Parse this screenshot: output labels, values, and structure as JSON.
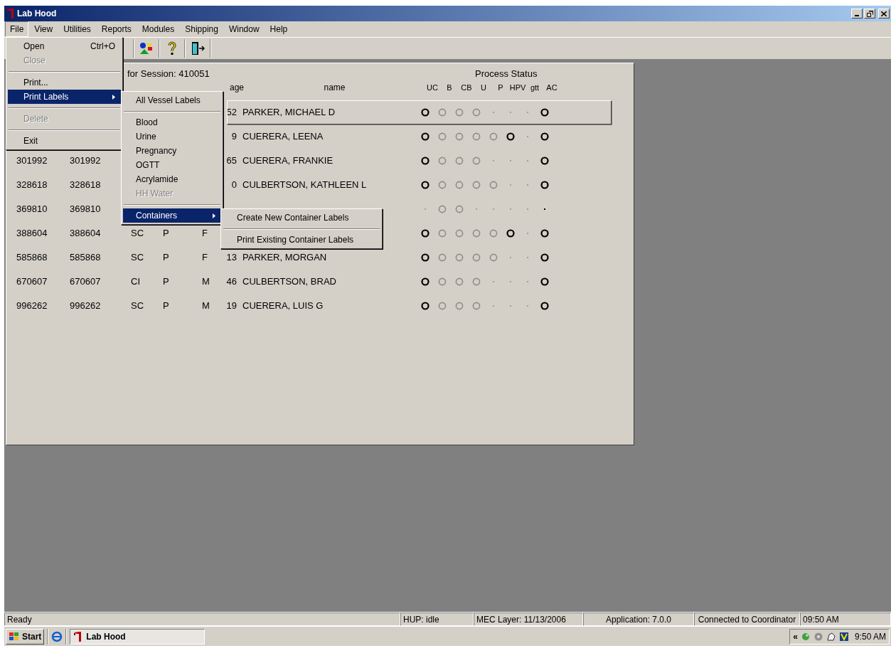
{
  "window": {
    "title": "Lab Hood"
  },
  "menu_bar": [
    {
      "label": "File",
      "selected": true
    },
    {
      "label": "View",
      "selected": false
    },
    {
      "label": "Utilities",
      "selected": false
    },
    {
      "label": "Reports",
      "selected": false
    },
    {
      "label": "Modules",
      "selected": false
    },
    {
      "label": "Shipping",
      "selected": false
    },
    {
      "label": "Window",
      "selected": false
    },
    {
      "label": "Help",
      "selected": false
    }
  ],
  "toolbar": [
    {
      "kind": "shapes"
    },
    {
      "kind": "help"
    },
    {
      "kind": "exit"
    }
  ],
  "participant_list": {
    "heading": "for Session: 410051",
    "process_heading": "Process Status",
    "age_header": "age",
    "name_header": "name",
    "status_columns": [
      "UC",
      "B",
      "CB",
      "U",
      "P",
      "HPV",
      "gtt",
      "AC"
    ],
    "rows": [
      {
        "selected": true,
        "age": "52",
        "name": "PARKER, MICHAEL D",
        "status": [
          {
            "kind": "bold"
          },
          {
            "kind": "grey"
          },
          {
            "kind": "grey"
          },
          {
            "kind": "grey"
          },
          {
            "kind": "dot"
          },
          {
            "kind": "dot"
          },
          {
            "kind": "dot"
          },
          {
            "kind": "bold"
          }
        ]
      },
      {
        "selected": false,
        "age": "9",
        "name": "CUERERA, LEENA",
        "status": [
          {
            "kind": "bold"
          },
          {
            "kind": "grey"
          },
          {
            "kind": "grey"
          },
          {
            "kind": "grey"
          },
          {
            "kind": "grey"
          },
          {
            "kind": "bold"
          },
          {
            "kind": "dot"
          },
          {
            "kind": "bold"
          }
        ]
      },
      {
        "selected": false,
        "id": "301992",
        "id_2": "301992",
        "age": "65",
        "name": "CUERERA, FRANKIE",
        "status": [
          {
            "kind": "bold"
          },
          {
            "kind": "grey"
          },
          {
            "kind": "grey"
          },
          {
            "kind": "grey"
          },
          {
            "kind": "dot"
          },
          {
            "kind": "dot"
          },
          {
            "kind": "dot"
          },
          {
            "kind": "bold"
          }
        ]
      },
      {
        "selected": false,
        "id": "328618",
        "id_2": "328618",
        "age": "0",
        "name": "CULBERTSON, KATHLEEN L",
        "status": [
          {
            "kind": "bold"
          },
          {
            "kind": "grey"
          },
          {
            "kind": "grey"
          },
          {
            "kind": "grey"
          },
          {
            "kind": "grey"
          },
          {
            "kind": "dot"
          },
          {
            "kind": "dot"
          },
          {
            "kind": "bold"
          }
        ]
      },
      {
        "selected": false,
        "id": "369810",
        "id_2": "369810",
        "status": [
          {
            "kind": "dot"
          },
          {
            "kind": "grey"
          },
          {
            "kind": "grey"
          },
          {
            "kind": "dot"
          },
          {
            "kind": "dot"
          },
          {
            "kind": "dot"
          },
          {
            "kind": "dot"
          },
          {
            "kind": "bold-dot"
          }
        ]
      },
      {
        "selected": false,
        "id": "388604",
        "id_2": "388604",
        "status_code": "SC",
        "type": "P",
        "gender": "F",
        "status": [
          {
            "kind": "bold"
          },
          {
            "kind": "grey"
          },
          {
            "kind": "grey"
          },
          {
            "kind": "grey"
          },
          {
            "kind": "grey"
          },
          {
            "kind": "bold"
          },
          {
            "kind": "dot"
          },
          {
            "kind": "bold"
          }
        ]
      },
      {
        "selected": false,
        "id": "585868",
        "id_2": "585868",
        "status_code": "SC",
        "type": "P",
        "gender": "F",
        "age": "13",
        "name": "PARKER, MORGAN",
        "status": [
          {
            "kind": "bold"
          },
          {
            "kind": "grey"
          },
          {
            "kind": "grey"
          },
          {
            "kind": "grey"
          },
          {
            "kind": "grey"
          },
          {
            "kind": "dot"
          },
          {
            "kind": "dot"
          },
          {
            "kind": "bold"
          }
        ]
      },
      {
        "selected": false,
        "id": "670607",
        "id_2": "670607",
        "status_code": "CI",
        "type": "P",
        "gender": "M",
        "age": "46",
        "name": "CULBERTSON, BRAD",
        "status": [
          {
            "kind": "bold"
          },
          {
            "kind": "grey"
          },
          {
            "kind": "grey"
          },
          {
            "kind": "grey"
          },
          {
            "kind": "dot"
          },
          {
            "kind": "dot"
          },
          {
            "kind": "dot"
          },
          {
            "kind": "bold"
          }
        ]
      },
      {
        "selected": false,
        "id": "996262",
        "id_2": "996262",
        "status_code": "SC",
        "type": "P",
        "gender": "M",
        "age": "19",
        "name": "CUERERA, LUIS G",
        "status": [
          {
            "kind": "bold"
          },
          {
            "kind": "grey"
          },
          {
            "kind": "grey"
          },
          {
            "kind": "grey"
          },
          {
            "kind": "dot"
          },
          {
            "kind": "dot"
          },
          {
            "kind": "dot"
          },
          {
            "kind": "bold"
          }
        ]
      }
    ]
  },
  "file_menu": [
    {
      "kind": "item",
      "label": "Open",
      "shortcut": "Ctrl+O",
      "disabled": false,
      "selected": false
    },
    {
      "kind": "item",
      "label": "Close",
      "disabled": true,
      "selected": false
    },
    {
      "kind": "separator"
    },
    {
      "kind": "item",
      "label": "Print...",
      "disabled": false,
      "selected": false
    },
    {
      "kind": "item",
      "label": "Print Labels",
      "disabled": false,
      "selected": true,
      "submenu": true
    },
    {
      "kind": "separator"
    },
    {
      "kind": "item",
      "label": "Delete",
      "disabled": true,
      "selected": false
    },
    {
      "kind": "separator"
    },
    {
      "kind": "item",
      "label": "Exit",
      "disabled": false,
      "selected": false
    }
  ],
  "print_labels_menu": [
    {
      "kind": "item",
      "label": "All Vessel Labels",
      "disabled": false,
      "selected": false
    },
    {
      "kind": "separator"
    },
    {
      "kind": "item",
      "label": "Blood",
      "disabled": false,
      "selected": false
    },
    {
      "kind": "item",
      "label": "Urine",
      "disabled": false,
      "selected": false
    },
    {
      "kind": "item",
      "label": "Pregnancy",
      "disabled": false,
      "selected": false
    },
    {
      "kind": "item",
      "label": "OGTT",
      "disabled": false,
      "selected": false
    },
    {
      "kind": "item",
      "label": "Acrylamide",
      "disabled": false,
      "selected": false
    },
    {
      "kind": "item",
      "label": "HH Water",
      "disabled": true,
      "selected": false
    },
    {
      "kind": "separator"
    },
    {
      "kind": "item",
      "label": "Containers",
      "disabled": false,
      "selected": true,
      "submenu": true
    }
  ],
  "containers_menu": [
    {
      "kind": "item",
      "label": "Create New Container Labels",
      "disabled": false,
      "selected": false
    },
    {
      "kind": "separator"
    },
    {
      "kind": "item",
      "label": "Print Existing Container Labels",
      "disabled": false,
      "selected": false
    }
  ],
  "status_bar": [
    "Ready",
    "HUP: idle",
    "MEC Layer: 11/13/2006",
    "Application: 7.0.0",
    "Connected to Coordinator",
    "09:50 AM"
  ],
  "taskbar": {
    "start": "Start",
    "tasks": [
      {
        "label": "Lab Hood",
        "selected": true
      }
    ],
    "tray_chevron": "«",
    "clock": "9:50 AM"
  }
}
